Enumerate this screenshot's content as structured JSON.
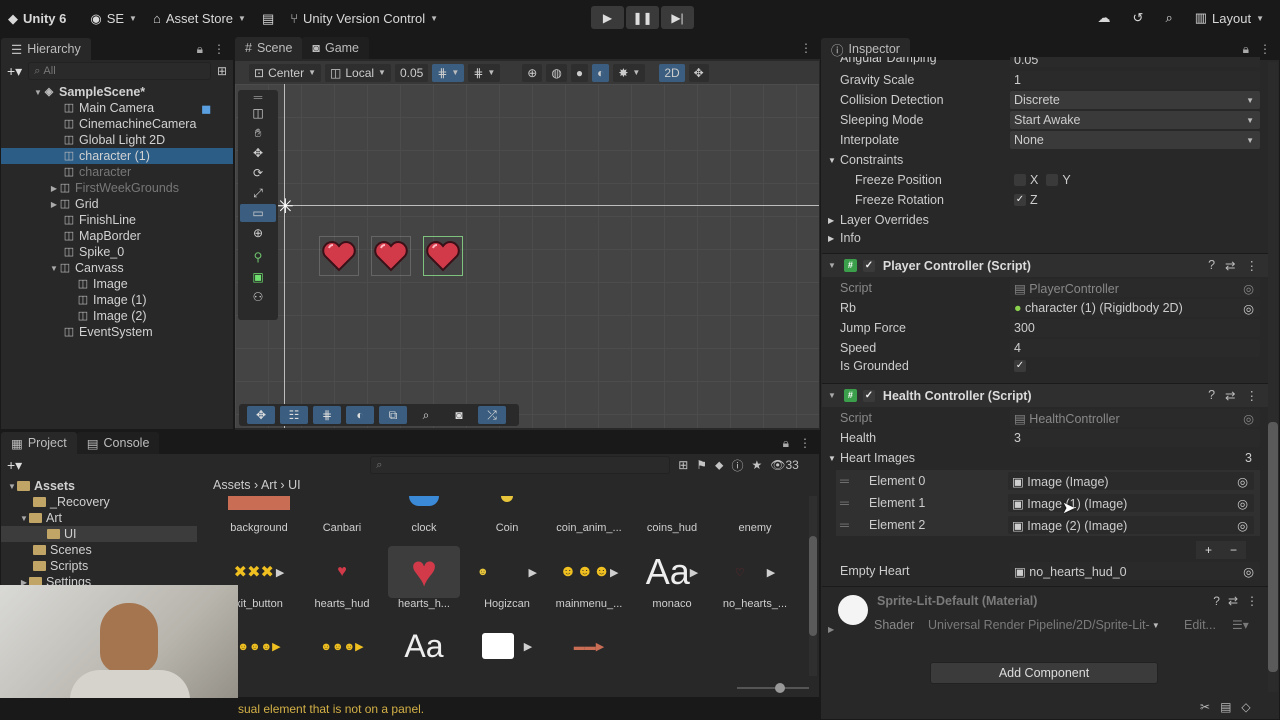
{
  "toolbar": {
    "product": "Unity 6",
    "account": "SE",
    "asset_store": "Asset Store",
    "version_control": "Unity Version Control",
    "layout": "Layout"
  },
  "hierarchy": {
    "tab": "Hierarchy",
    "search_placeholder": "All",
    "scene": "SampleScene*",
    "items": [
      {
        "label": "Main Camera",
        "level": 1
      },
      {
        "label": "CinemachineCamera",
        "level": 1
      },
      {
        "label": "Global Light 2D",
        "level": 1
      },
      {
        "label": "character (1)",
        "level": 1
      },
      {
        "label": "character",
        "level": 1
      },
      {
        "label": "FirstWeekGrounds",
        "level": 1
      },
      {
        "label": "Grid",
        "level": 1
      },
      {
        "label": "FinishLine",
        "level": 1
      },
      {
        "label": "MapBorder",
        "level": 1
      },
      {
        "label": "Spike_0",
        "level": 1
      },
      {
        "label": "Canvass",
        "level": 1
      },
      {
        "label": "Image",
        "level": 2
      },
      {
        "label": "Image (1)",
        "level": 2
      },
      {
        "label": "Image (2)",
        "level": 2
      },
      {
        "label": "EventSystem",
        "level": 1
      }
    ]
  },
  "scene": {
    "tab_scene": "Scene",
    "tab_game": "Game",
    "pivot": "Center",
    "space": "Local",
    "snap": "0.05",
    "mode_2d": "2D"
  },
  "project": {
    "tab_project": "Project",
    "tab_console": "Console",
    "count": "33",
    "tree": [
      {
        "label": "Assets"
      },
      {
        "label": "_Recovery"
      },
      {
        "label": "Art"
      },
      {
        "label": "UI"
      },
      {
        "label": "Scenes"
      },
      {
        "label": "Scripts"
      },
      {
        "label": "Settings"
      }
    ],
    "breadcrumb": [
      "Assets",
      "Art",
      "UI"
    ],
    "assets_row1": [
      "background",
      "Canbari",
      "clock",
      "Coin",
      "coin_anim_...",
      "coins_hud",
      "enemy"
    ],
    "assets_row2": [
      "xit_button",
      "hearts_hud",
      "hearts_h...",
      "Hogizcan",
      "mainmenu_...",
      "monaco",
      "no_hearts_..."
    ],
    "font_glyph": "Aa"
  },
  "inspector": {
    "tab": "Inspector",
    "rigidbody": {
      "angular_damping_label": "Angular Damping",
      "angular_damping": "0.05",
      "gravity_label": "Gravity Scale",
      "gravity": "1",
      "collision_label": "Collision Detection",
      "collision": "Discrete",
      "sleeping_label": "Sleeping Mode",
      "sleeping": "Start Awake",
      "interpolate_label": "Interpolate",
      "interpolate": "None",
      "constraints_label": "Constraints",
      "freeze_pos_label": "Freeze Position",
      "freeze_rot_label": "Freeze Rotation",
      "axis_x": "X",
      "axis_y": "Y",
      "axis_z": "Z",
      "layer_overrides": "Layer Overrides",
      "info": "Info"
    },
    "player": {
      "title": "Player Controller (Script)",
      "script_label": "Script",
      "script": "PlayerController",
      "rb_label": "Rb",
      "rb": "character (1) (Rigidbody 2D)",
      "jump_label": "Jump Force",
      "jump": "300",
      "speed_label": "Speed",
      "speed": "4",
      "grounded_label": "Is Grounded"
    },
    "health": {
      "title": "Health Controller (Script)",
      "script_label": "Script",
      "script": "HealthController",
      "health_label": "Health",
      "health": "3",
      "images_label": "Heart Images",
      "images_count": "3",
      "elements": [
        {
          "label": "Element 0",
          "value": "Image (Image)"
        },
        {
          "label": "Element 1",
          "value": "Image (1) (Image)"
        },
        {
          "label": "Element 2",
          "value": "Image (2) (Image)"
        }
      ],
      "empty_label": "Empty Heart",
      "empty": "no_hearts_hud_0"
    },
    "material": {
      "name": "Sprite-Lit-Default (Material)",
      "shader_label": "Shader",
      "shader": "Universal Render Pipeline/2D/Sprite-Lit-",
      "edit": "Edit..."
    },
    "add_component": "Add Component"
  },
  "status": "sual element that is not on a panel."
}
